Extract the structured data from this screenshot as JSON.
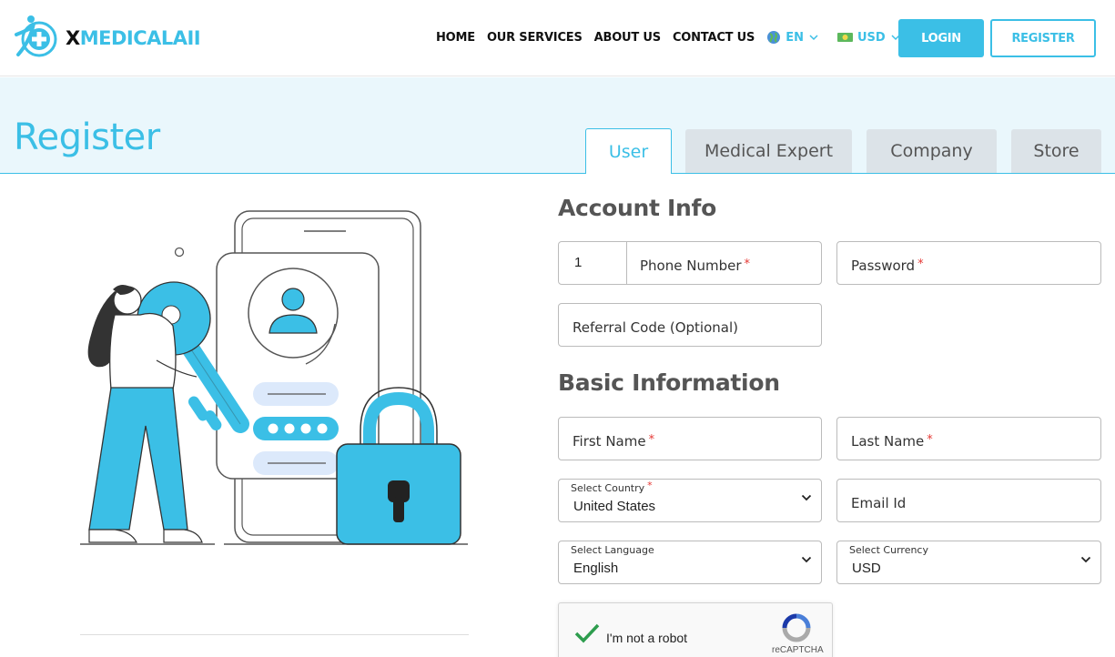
{
  "header": {
    "logo": {
      "prefix": "X",
      "rest": "MEDICALAII"
    },
    "nav": [
      "HOME",
      "OUR SERVICES",
      "ABOUT US",
      "CONTACT US"
    ],
    "language": "EN",
    "currency": "USD",
    "login_label": "LOGIN",
    "register_label": "REGISTER"
  },
  "page": {
    "title": "Register",
    "tabs": [
      "User",
      "Medical Expert",
      "Company",
      "Store"
    ],
    "active_tab": "User"
  },
  "form": {
    "account_info_title": "Account Info",
    "phone_code": "1",
    "phone_label": "Phone Number",
    "password_label": "Password",
    "referral_label": "Referral Code (Optional)",
    "basic_info_title": "Basic Information",
    "first_name_label": "First Name",
    "last_name_label": "Last Name",
    "country_label": "Select Country",
    "country_value": "United States",
    "email_label": "Email Id",
    "language_label": "Select Language",
    "language_value": "English",
    "currency_label": "Select Currency",
    "currency_value": "USD",
    "required_mark": "*"
  },
  "recaptcha": {
    "text": "I'm not a robot",
    "brand": "reCAPTCHA"
  },
  "colors": {
    "accent": "#3bbfe6",
    "band": "#eaf7fc",
    "tab_inactive": "#dce3e8",
    "required": "#e53935"
  }
}
